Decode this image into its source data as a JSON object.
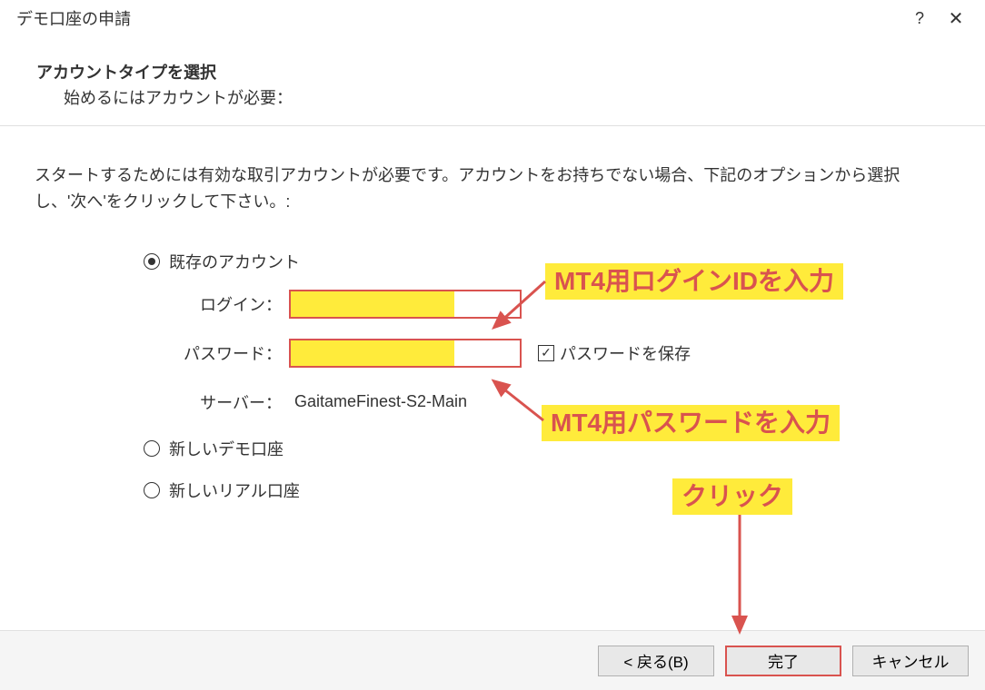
{
  "window": {
    "title": "デモ口座の申請",
    "help": "?",
    "close": "✕"
  },
  "header": {
    "title": "アカウントタイプを選択",
    "subtitle": "始めるにはアカウントが必要："
  },
  "instruction": "スタートするためには有効な取引アカウントが必要です。アカウントをお持ちでない場合、下記のオプションから選択し、'次へ'をクリックして下さい。:",
  "radio": {
    "existing": "既存のアカウント",
    "new_demo": "新しいデモ口座",
    "new_real": "新しいリアル口座"
  },
  "form": {
    "login_label": "ログイン：",
    "password_label": "パスワード：",
    "save_password_label": "パスワードを保存",
    "server_label": "サーバー：",
    "server_value": "GaitameFinest-S2-Main",
    "checkbox_mark": "✓"
  },
  "footer": {
    "back": "< 戻る(B)",
    "finish": "完了",
    "cancel": "キャンセル"
  },
  "annotations": {
    "login": "MT4用ログインIDを入力",
    "password": "MT4用パスワードを入力",
    "click": "クリック"
  }
}
